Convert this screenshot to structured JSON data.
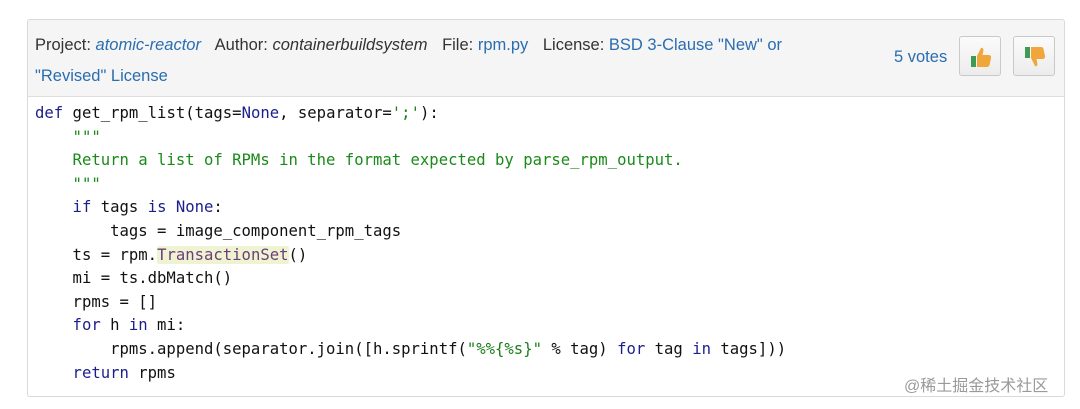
{
  "header": {
    "project_label": "Project:",
    "project": "atomic-reactor",
    "author_label": "Author:",
    "author": "containerbuildsystem",
    "file_label": "File:",
    "file": "rpm.py",
    "license_label": "License:",
    "license_line1": "BSD 3-Clause \"New\" or",
    "license_line2": "\"Revised\" License",
    "votes": "5 votes"
  },
  "code": {
    "l1_def": "def",
    "l1_rest": " get_rpm_list(tags=",
    "l1_none": "None",
    "l1_mid": ", separator=",
    "l1_str": "';'",
    "l1_end": "):",
    "l2": "    \"\"\"",
    "l3": "    Return a list of RPMs in the format expected by parse_rpm_output.",
    "l4": "    \"\"\"",
    "l5_if": "    if",
    "l5_mid": " tags ",
    "l5_is": "is",
    "l5_sp": " ",
    "l5_none": "None",
    "l5_end": ":",
    "l6": "        tags = image_component_rpm_tags",
    "l7_pre": "    ts = rpm.",
    "l7_hl": "TransactionSet",
    "l7_end": "()",
    "l8": "    mi = ts.dbMatch()",
    "l9": "    rpms = []",
    "l10_for": "    for",
    "l10_mid": " h ",
    "l10_in": "in",
    "l10_end": " mi:",
    "l11_pre": "        rpms.append(separator.join([h.sprintf(",
    "l11_str": "\"%%{%s}\"",
    "l11_mid": " % tag) ",
    "l11_for": "for",
    "l11_mid2": " tag ",
    "l11_in": "in",
    "l11_end": " tags]))",
    "l12_ret": "    return",
    "l12_end": " rpms"
  },
  "watermark": "@稀土掘金技术社区",
  "colors": {
    "link": "#2a6db0",
    "keyword": "#1b1f8a",
    "docstring": "#1a8a1a"
  },
  "icons": [
    "thumbs-up-icon",
    "thumbs-down-icon"
  ]
}
